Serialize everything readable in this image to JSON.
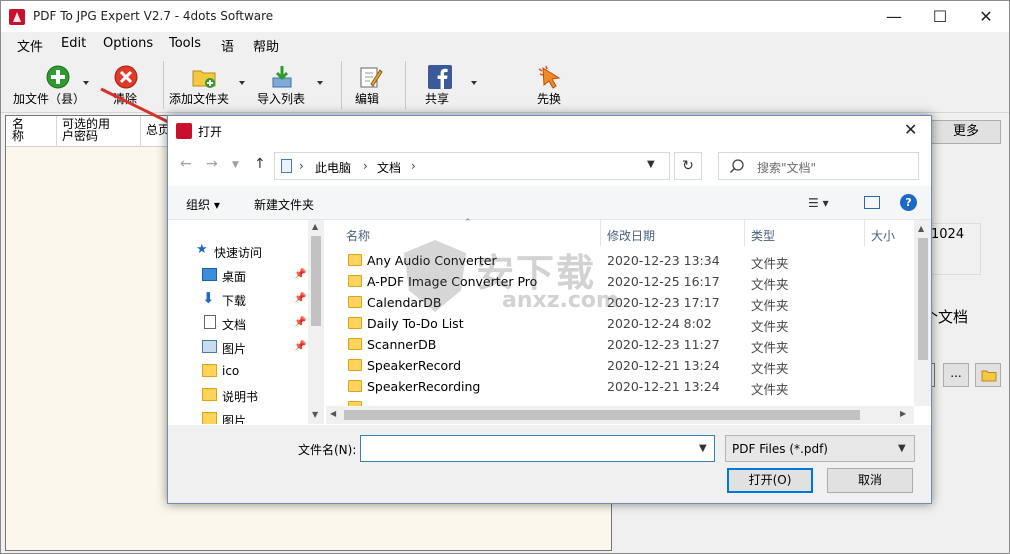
{
  "app": {
    "title": "PDF To JPG Expert V2.7 - 4dots Software",
    "menu": [
      "文件",
      "Edit",
      "Options",
      "Tools",
      "语",
      "帮助"
    ],
    "toolbar": {
      "add_file": "加文件（县）",
      "clear": "清除",
      "add_folder": "添加文件夹",
      "import_list": "导入列表",
      "edit": "编辑",
      "share": "共享",
      "buy": "先换"
    },
    "list_columns": [
      {
        "l1": "名",
        "l2": "称"
      },
      {
        "l1": "可选的用",
        "l2": "户密码"
      },
      {
        "l1": "总页",
        "l2": ""
      }
    ],
    "right_panel": {
      "more": "更多",
      "size_value": "1024",
      "docs_label": "个文档",
      "dots": "..."
    }
  },
  "dialog": {
    "title": "打开",
    "breadcrumb": [
      "此电脑",
      "文档"
    ],
    "search_placeholder": "搜索\"文档\"",
    "organize": "组织 ▾",
    "new_folder": "新建文件夹",
    "nav_items": [
      {
        "label": "快速访问",
        "icon": "star-icon",
        "pinned": false
      },
      {
        "label": "桌面",
        "icon": "desktop-icon",
        "pinned": true
      },
      {
        "label": "下载",
        "icon": "download-icon",
        "pinned": true
      },
      {
        "label": "文档",
        "icon": "document-icon",
        "pinned": true
      },
      {
        "label": "图片",
        "icon": "picture-icon",
        "pinned": true
      },
      {
        "label": "ico",
        "icon": "folder-icon",
        "pinned": false
      },
      {
        "label": "说明书",
        "icon": "folder-icon",
        "pinned": false
      },
      {
        "label": "图片",
        "icon": "folder-icon",
        "pinned": false
      }
    ],
    "columns": {
      "name": "名称",
      "date": "修改日期",
      "type": "类型",
      "size": "大小"
    },
    "files": [
      {
        "name": "Any Audio Converter",
        "date": "2020-12-23 13:34",
        "type": "文件夹"
      },
      {
        "name": "A-PDF Image Converter Pro",
        "date": "2020-12-25 16:17",
        "type": "文件夹"
      },
      {
        "name": "CalendarDB",
        "date": "2020-12-23 17:17",
        "type": "文件夹"
      },
      {
        "name": "Daily To-Do List",
        "date": "2020-12-24 8:02",
        "type": "文件夹"
      },
      {
        "name": "ScannerDB",
        "date": "2020-12-23 11:27",
        "type": "文件夹"
      },
      {
        "name": "SpeakerRecord",
        "date": "2020-12-21 13:24",
        "type": "文件夹"
      },
      {
        "name": "SpeakerRecording",
        "date": "2020-12-21 13:24",
        "type": "文件夹"
      }
    ],
    "filename_label": "文件名(N):",
    "filename_value": "",
    "filter": "PDF Files (*.pdf)",
    "open_button": "打开(O)",
    "cancel_button": "取消"
  },
  "watermark": {
    "text": "安下载",
    "sub": "anxz.com"
  },
  "colors": {
    "accent": "#0078d7",
    "list_bg": "#fbf7ec",
    "arrow": "#d9302c"
  }
}
